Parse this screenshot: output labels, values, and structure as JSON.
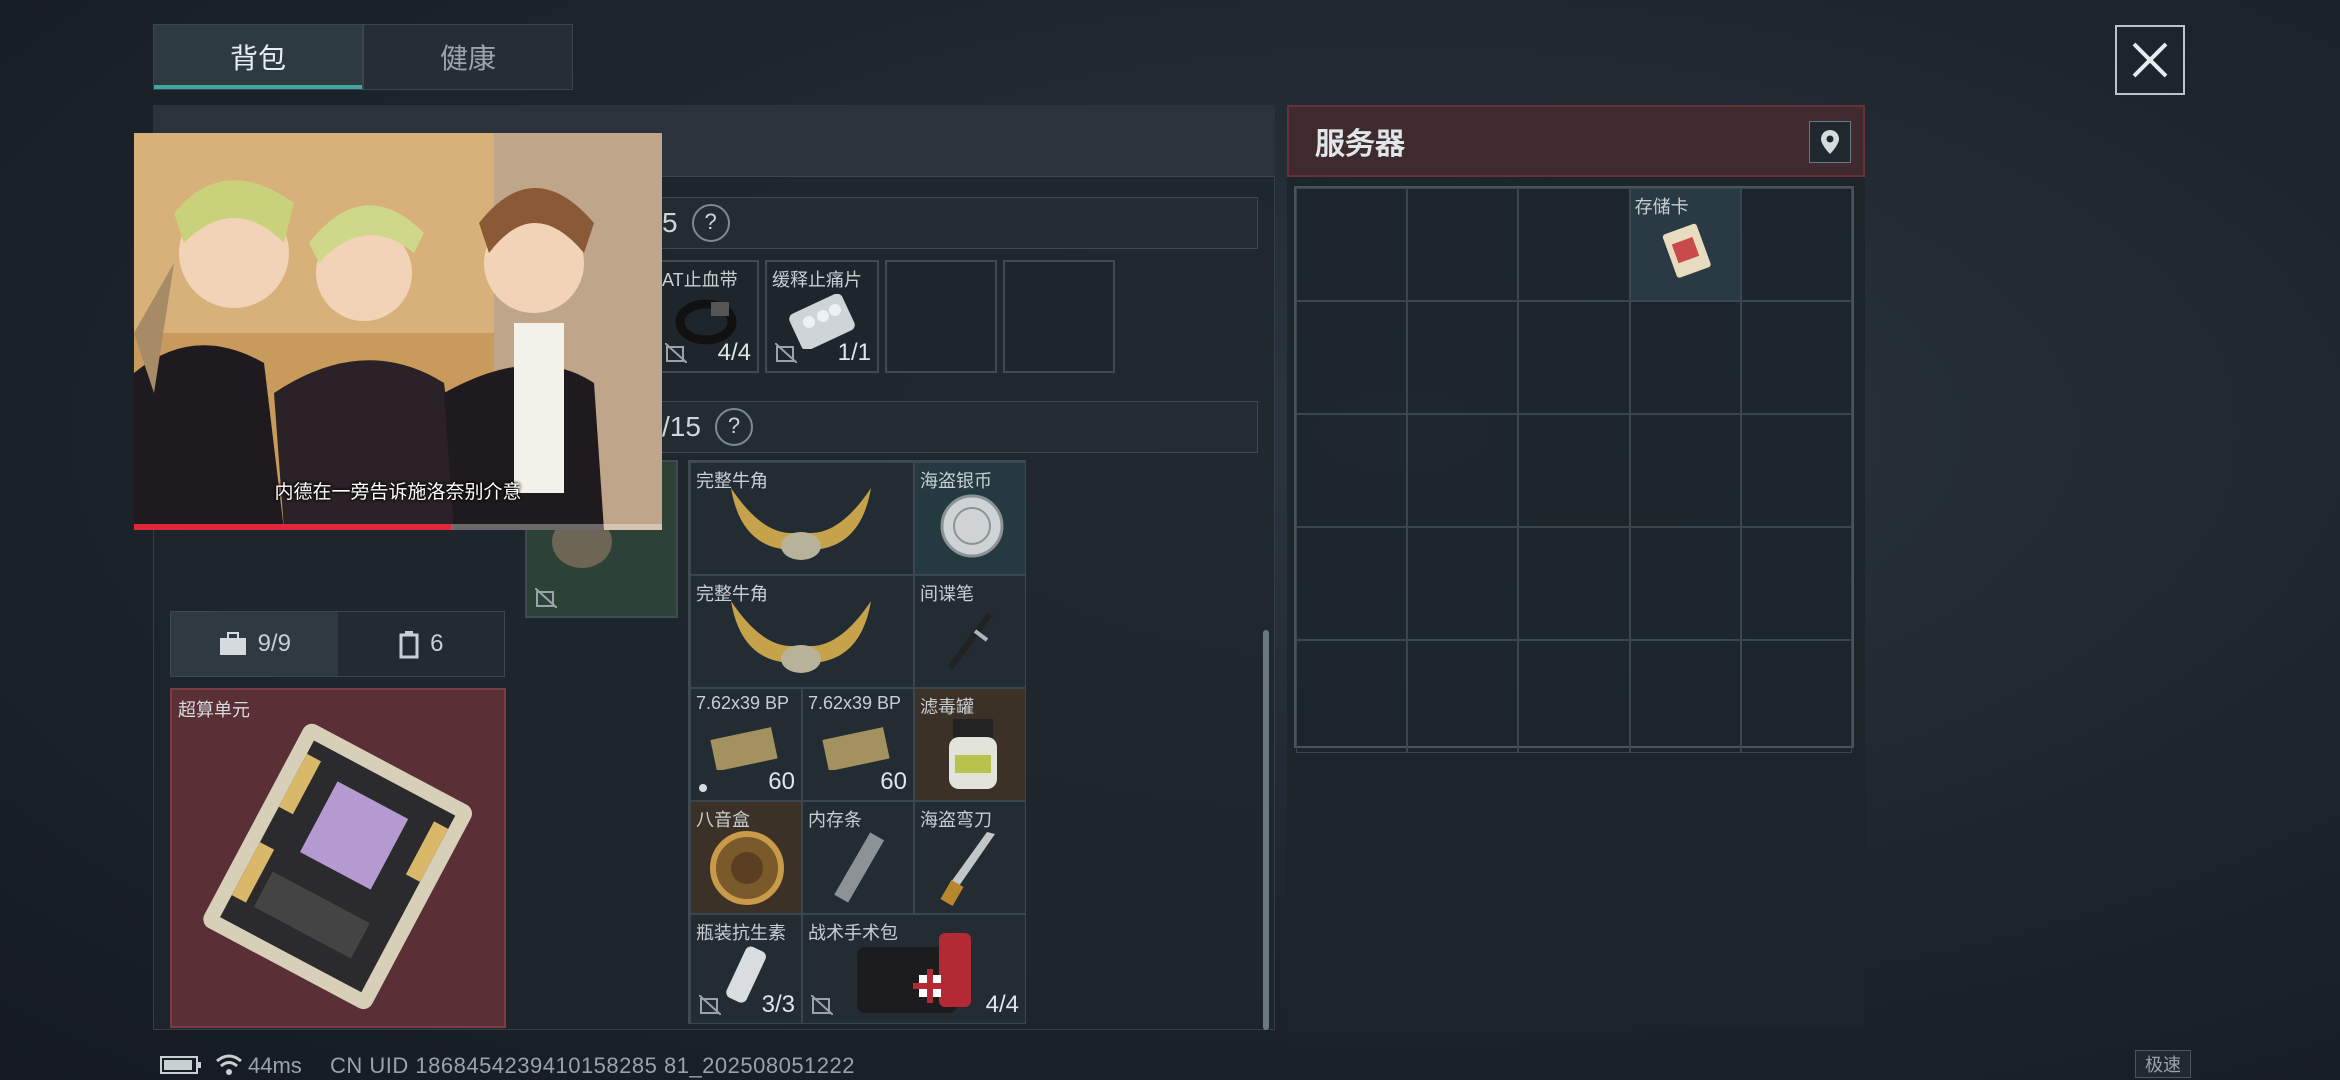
{
  "tabs": [
    {
      "label": "背包",
      "active": true
    },
    {
      "label": "健康",
      "active": false
    }
  ],
  "close_icon": "close-icon",
  "sections": {
    "first_capacity": "5",
    "second_capacity": "/15",
    "help_glyph": "?"
  },
  "small_slots": [
    {
      "label": "AT止血带",
      "count": "4/4"
    },
    {
      "label": "缓释止痛片",
      "count": "1/1"
    }
  ],
  "backpack_items": [
    {
      "label": "完整牛角",
      "count": ""
    },
    {
      "label": "海盗银币",
      "count": ""
    },
    {
      "label": "完整牛角",
      "count": ""
    },
    {
      "label": "间谍笔",
      "count": ""
    },
    {
      "label": "7.62x39 BP",
      "count": "60"
    },
    {
      "label": "7.62x39 BP",
      "count": "60"
    },
    {
      "label": "滤毒罐",
      "count": ""
    },
    {
      "label": "八音盒",
      "count": ""
    },
    {
      "label": "内存条",
      "count": ""
    },
    {
      "label": "海盗弯刀",
      "count": ""
    },
    {
      "label": "瓶装抗生素",
      "count": "3/3"
    },
    {
      "label": "战术手术包",
      "count": "4/4"
    }
  ],
  "capacity_tabs": [
    {
      "icon": "briefcase-icon",
      "label": "9/9"
    },
    {
      "icon": "container-icon",
      "label": "6"
    }
  ],
  "red_slot": {
    "label": "超算单元"
  },
  "server": {
    "title": "服务器",
    "location_icon": "location-pin-icon",
    "item": {
      "label": "存储卡"
    }
  },
  "video": {
    "subtitle": "内德在一旁告诉施洛奈别介意",
    "progress": 0.6
  },
  "status": {
    "battery_icon": "battery-icon",
    "wifi_icon": "wifi-icon",
    "ping": "44ms",
    "uid": "CN UID 1868454239410158285 81_202508051222",
    "speed_label": "极速"
  }
}
